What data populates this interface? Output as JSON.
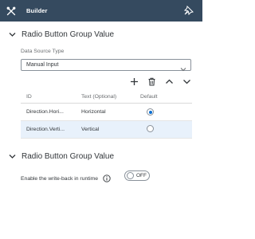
{
  "header": {
    "title": "Builder",
    "tools_icon": "wrench-icon",
    "pin_icon": "pin-icon",
    "bg_color": "#354a5f"
  },
  "section1": {
    "title": "Radio Button Group Value",
    "data_source_label": "Data Source Type",
    "data_source_value": "Manual Input"
  },
  "toolbar": {
    "add_icon": "plus-icon",
    "delete_icon": "trash-icon",
    "up_icon": "chevron-up-icon",
    "down_icon": "chevron-down-icon"
  },
  "table": {
    "columns": [
      "ID",
      "Text (Optional)",
      "Default"
    ],
    "rows": [
      {
        "id": "Direction.Hori...",
        "text": "Horizontal",
        "default": true
      },
      {
        "id": "Direction.Verti...",
        "text": "Vertical",
        "default": false
      }
    ],
    "selected_row_color": "#e8f1fb"
  },
  "section2": {
    "title": "Radio Button Group Value",
    "writeback_label": "Enable the write-back in runtime",
    "switch_text": "OFF"
  },
  "colors": {
    "accent": "#0a6ed1",
    "text": "#32363a",
    "muted": "#6a6d70"
  }
}
